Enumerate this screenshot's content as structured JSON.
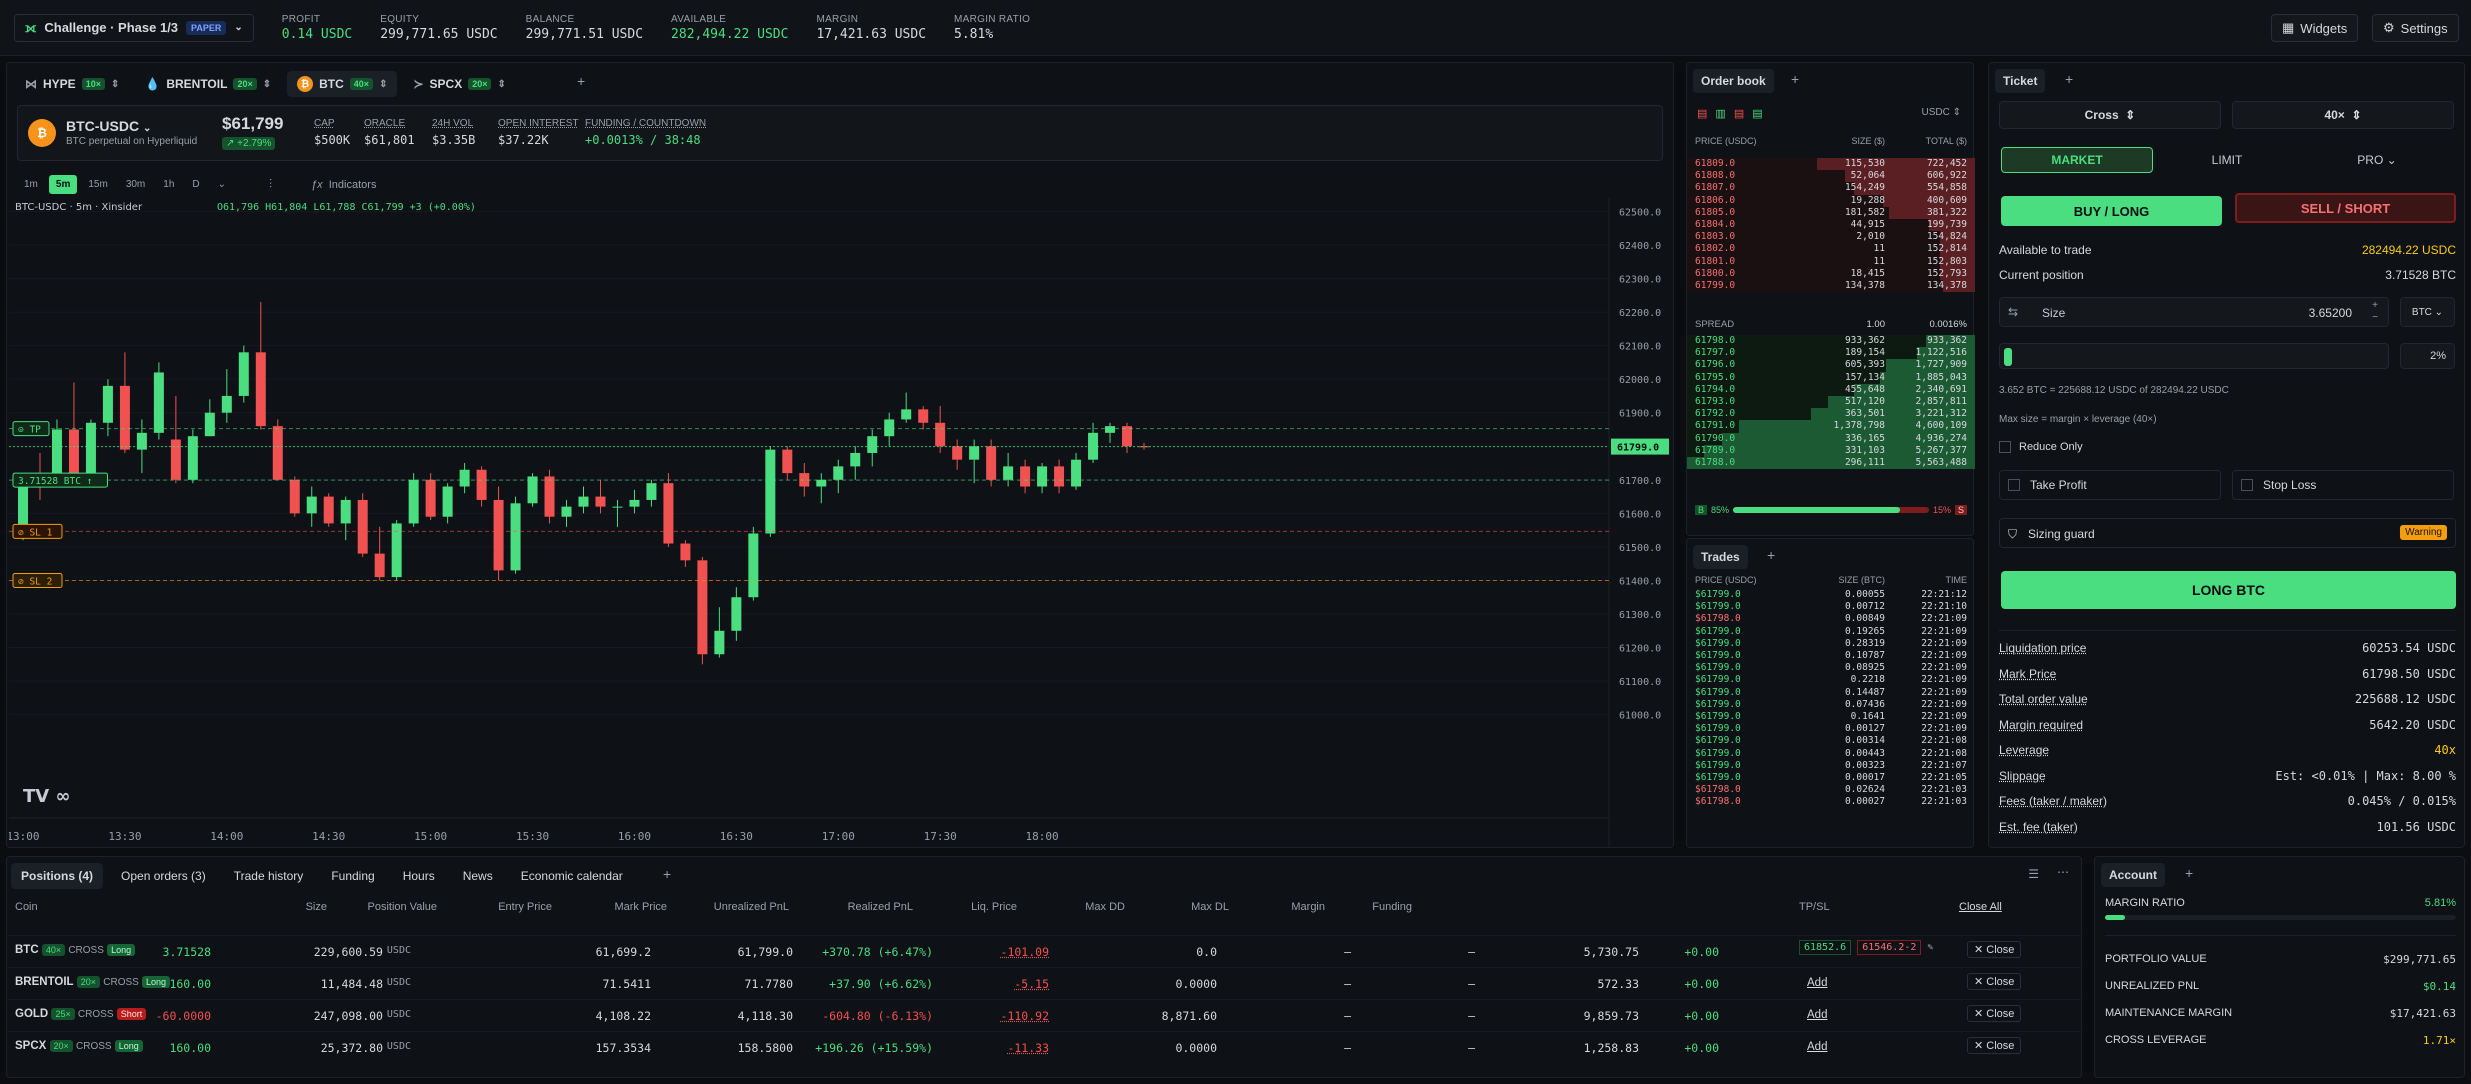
{
  "topbar": {
    "challenge": "Challenge · Phase 1/3",
    "mode": "PAPER",
    "stats": [
      {
        "label": "PROFIT",
        "value": "0.14 USDC",
        "color": "#4ade80"
      },
      {
        "label": "EQUITY",
        "value": "299,771.65 USDC",
        "color": "#d6d9de"
      },
      {
        "label": "BALANCE",
        "value": "299,771.51 USDC",
        "color": "#d6d9de"
      },
      {
        "label": "AVAILABLE",
        "value": "282,494.22 USDC",
        "color": "#4ade80"
      },
      {
        "label": "MARGIN",
        "value": "17,421.63 USDC",
        "color": "#d6d9de"
      },
      {
        "label": "MARGIN RATIO",
        "value": "5.81%",
        "color": "#d6d9de"
      }
    ],
    "widgets": "Widgets",
    "settings": "Settings"
  },
  "chart_tabs": [
    {
      "name": "HYPE",
      "lev": "10×"
    },
    {
      "name": "BRENTOIL",
      "lev": "20×"
    },
    {
      "name": "BTC",
      "lev": "40×"
    },
    {
      "name": "SPCX",
      "lev": "20×"
    }
  ],
  "market": {
    "pair": "BTC-USDC",
    "sub": "BTC perpetual on Hyperliquid",
    "price": "$61,799",
    "change": "+2.79%",
    "items": [
      {
        "label": "CAP",
        "value": "$500K"
      },
      {
        "label": "ORACLE",
        "value": "$61,801"
      },
      {
        "label": "24H VOL",
        "value": "$3.35B"
      },
      {
        "label": "OPEN INTEREST",
        "value": "$37.22K"
      },
      {
        "label": "FUNDING / COUNTDOWN",
        "value": "+0.0013% / 38:48"
      }
    ]
  },
  "timeframes": [
    "1m",
    "5m",
    "15m",
    "30m",
    "1h",
    "D"
  ],
  "indicators": "Indicators",
  "chart_data": {
    "type": "candlestick",
    "title": "BTC-USDC · 5m · Xinsider",
    "ohlc_legend": "O61,796 H61,804 L61,788 C61,799 +3 (+0.00%)",
    "yticks": [
      62500,
      62400,
      62300,
      62200,
      62100,
      62000,
      61900,
      61800,
      61700,
      61600,
      61500,
      61400,
      61300,
      61200,
      61100,
      61000
    ],
    "ylim": [
      60990,
      62540
    ],
    "xticks": [
      "13:00",
      "13:30",
      "14:00",
      "14:30",
      "15:00",
      "15:30",
      "16:00",
      "16:30",
      "17:00",
      "17:30",
      "18:00"
    ],
    "candles": [
      [
        61550,
        61720,
        61520,
        61700
      ],
      [
        61700,
        61780,
        61640,
        61690
      ],
      [
        61690,
        61880,
        61680,
        61850
      ],
      [
        61850,
        61990,
        61700,
        61720
      ],
      [
        61720,
        61880,
        61720,
        61870
      ],
      [
        61870,
        62000,
        61830,
        61980
      ],
      [
        61980,
        62080,
        61780,
        61790
      ],
      [
        61790,
        61880,
        61720,
        61840
      ],
      [
        61840,
        62050,
        61820,
        62020
      ],
      [
        61820,
        61950,
        61690,
        61700
      ],
      [
        61700,
        61850,
        61690,
        61830
      ],
      [
        61830,
        61940,
        61830,
        61900
      ],
      [
        61900,
        62030,
        61870,
        61950
      ],
      [
        61950,
        62100,
        61930,
        62080
      ],
      [
        62080,
        62230,
        61850,
        61860
      ],
      [
        61860,
        61880,
        61700,
        61700
      ],
      [
        61700,
        61710,
        61590,
        61600
      ],
      [
        61600,
        61680,
        61560,
        61650
      ],
      [
        61650,
        61660,
        61560,
        61570
      ],
      [
        61570,
        61650,
        61520,
        61640
      ],
      [
        61640,
        61660,
        61470,
        61480
      ],
      [
        61480,
        61560,
        61400,
        61410
      ],
      [
        61410,
        61580,
        61400,
        61570
      ],
      [
        61570,
        61720,
        61560,
        61700
      ],
      [
        61700,
        61720,
        61580,
        61590
      ],
      [
        61590,
        61690,
        61570,
        61680
      ],
      [
        61680,
        61750,
        61660,
        61730
      ],
      [
        61730,
        61740,
        61620,
        61640
      ],
      [
        61640,
        61680,
        61400,
        61430
      ],
      [
        61430,
        61650,
        61420,
        61630
      ],
      [
        61630,
        61720,
        61620,
        61710
      ],
      [
        61710,
        61730,
        61570,
        61590
      ],
      [
        61590,
        61640,
        61560,
        61620
      ],
      [
        61620,
        61680,
        61600,
        61650
      ],
      [
        61650,
        61700,
        61600,
        61620
      ],
      [
        61620,
        61640,
        61560,
        61620
      ],
      [
        61620,
        61670,
        61600,
        61640
      ],
      [
        61640,
        61700,
        61620,
        61690
      ],
      [
        61690,
        61720,
        61500,
        61510
      ],
      [
        61510,
        61520,
        61440,
        61460
      ],
      [
        61460,
        61470,
        61150,
        61180
      ],
      [
        61180,
        61320,
        61170,
        61250
      ],
      [
        61250,
        61380,
        61220,
        61350
      ],
      [
        61350,
        61560,
        61340,
        61540
      ],
      [
        61540,
        61800,
        61530,
        61790
      ],
      [
        61790,
        61800,
        61700,
        61720
      ],
      [
        61720,
        61750,
        61650,
        61680
      ],
      [
        61680,
        61720,
        61630,
        61700
      ],
      [
        61700,
        61760,
        61660,
        61740
      ],
      [
        61740,
        61800,
        61700,
        61780
      ],
      [
        61780,
        61850,
        61740,
        61830
      ],
      [
        61830,
        61900,
        61800,
        61880
      ],
      [
        61880,
        61960,
        61870,
        61910
      ],
      [
        61910,
        61920,
        61850,
        61870
      ],
      [
        61870,
        61920,
        61780,
        61800
      ],
      [
        61800,
        61820,
        61730,
        61760
      ],
      [
        61760,
        61820,
        61690,
        61800
      ],
      [
        61800,
        61820,
        61680,
        61700
      ],
      [
        61700,
        61780,
        61680,
        61740
      ],
      [
        61740,
        61760,
        61660,
        61680
      ],
      [
        61680,
        61750,
        61660,
        61740
      ],
      [
        61740,
        61760,
        61660,
        61680
      ],
      [
        61680,
        61780,
        61670,
        61760
      ],
      [
        61760,
        61870,
        61750,
        61840
      ],
      [
        61840,
        61870,
        61810,
        61860
      ],
      [
        61860,
        61870,
        61780,
        61800
      ],
      [
        61800,
        61810,
        61790,
        61799
      ]
    ],
    "hlines": [
      {
        "label": "TP",
        "price": 61852.6,
        "color": "#4ade80"
      },
      {
        "label": "3.71528 BTC",
        "price": 61699.2,
        "color": "#4ade80"
      },
      {
        "label": "SL 1",
        "price": 61546.2,
        "color": "#f05252"
      },
      {
        "label": "SL 2",
        "price": 61400,
        "color": "#f59e0b"
      }
    ],
    "last_price": "61799.0"
  },
  "orderbook": {
    "title": "Order book",
    "quote": "USDC",
    "headers": [
      "PRICE (USDC)",
      "SIZE ($)",
      "TOTAL ($)"
    ],
    "asks": [
      [
        "61809.0",
        "115,530",
        "722,452",
        0.55
      ],
      [
        "61808.0",
        "52,064",
        "606,922",
        0.45
      ],
      [
        "61807.0",
        "154,249",
        "554,858",
        0.42
      ],
      [
        "61806.0",
        "19,288",
        "400,609",
        0.32
      ],
      [
        "61805.0",
        "181,582",
        "381,322",
        0.3
      ],
      [
        "61804.0",
        "44,915",
        "199,739",
        0.16
      ],
      [
        "61803.0",
        "2,010",
        "154,824",
        0.12
      ],
      [
        "61802.0",
        "11",
        "152,814",
        0.12
      ],
      [
        "61801.0",
        "11",
        "152,803",
        0.12
      ],
      [
        "61800.0",
        "18,415",
        "152,793",
        0.12
      ],
      [
        "61799.0",
        "134,378",
        "134,378",
        0.11
      ]
    ],
    "spread": {
      "label": "SPREAD",
      "value": "1.00",
      "pct": "0.0016%"
    },
    "bids": [
      [
        "61798.0",
        "933,362",
        "933,362",
        0.17
      ],
      [
        "61797.0",
        "189,154",
        "1,122,516",
        0.2
      ],
      [
        "61796.0",
        "605,393",
        "1,727,909",
        0.31
      ],
      [
        "61795.0",
        "157,134",
        "1,885,043",
        0.33
      ],
      [
        "61794.0",
        "455,648",
        "2,340,691",
        0.42
      ],
      [
        "61793.0",
        "517,120",
        "2,857,811",
        0.51
      ],
      [
        "61792.0",
        "363,501",
        "3,221,312",
        0.57
      ],
      [
        "61791.0",
        "1,378,798",
        "4,600,109",
        0.82
      ],
      [
        "61790.0",
        "336,165",
        "4,936,274",
        0.88
      ],
      [
        "61789.0",
        "331,103",
        "5,267,377",
        0.94
      ],
      [
        "61788.0",
        "296,111",
        "5,563,488",
        1.0
      ]
    ],
    "ratio": {
      "b": "85%",
      "s": "15%"
    }
  },
  "trades": {
    "title": "Trades",
    "headers": [
      "PRICE (USDC)",
      "SIZE (BTC)",
      "TIME"
    ],
    "rows": [
      [
        "$61799.0",
        "0.00055",
        "22:21:12",
        "b"
      ],
      [
        "$61799.0",
        "0.00712",
        "22:21:10",
        "b"
      ],
      [
        "$61798.0",
        "0.00849",
        "22:21:09",
        "s"
      ],
      [
        "$61799.0",
        "0.19265",
        "22:21:09",
        "b"
      ],
      [
        "$61799.0",
        "0.28319",
        "22:21:09",
        "b"
      ],
      [
        "$61799.0",
        "0.10787",
        "22:21:09",
        "b"
      ],
      [
        "$61799.0",
        "0.08925",
        "22:21:09",
        "b"
      ],
      [
        "$61799.0",
        "0.2218",
        "22:21:09",
        "b"
      ],
      [
        "$61799.0",
        "0.14487",
        "22:21:09",
        "b"
      ],
      [
        "$61799.0",
        "0.07436",
        "22:21:09",
        "b"
      ],
      [
        "$61799.0",
        "0.1641",
        "22:21:09",
        "b"
      ],
      [
        "$61799.0",
        "0.00127",
        "22:21:09",
        "b"
      ],
      [
        "$61799.0",
        "0.00314",
        "22:21:08",
        "b"
      ],
      [
        "$61799.0",
        "0.00443",
        "22:21:08",
        "b"
      ],
      [
        "$61799.0",
        "0.00323",
        "22:21:07",
        "b"
      ],
      [
        "$61799.0",
        "0.00017",
        "22:21:05",
        "b"
      ],
      [
        "$61798.0",
        "0.02624",
        "22:21:03",
        "s"
      ],
      [
        "$61798.0",
        "0.00027",
        "22:21:03",
        "s"
      ]
    ]
  },
  "ticket": {
    "title": "Ticket",
    "margin_mode": "Cross",
    "leverage": "40×",
    "order_types": [
      "MARKET",
      "LIMIT",
      "PRO"
    ],
    "buy": "BUY / LONG",
    "sell": "SELL / SHORT",
    "available_label": "Available to trade",
    "available": "282494.22 USDC",
    "position_label": "Current position",
    "position": "3.71528 BTC",
    "size_label": "Size",
    "size": "3.65200",
    "size_unit": "BTC",
    "pct": "2%",
    "calc": "3.652 BTC = 225688.12 USDC of 282494.22 USDC",
    "maxsize": "Max size = margin × leverage (40×)",
    "reduce_only": "Reduce Only",
    "take_profit": "Take Profit",
    "stop_loss": "Stop Loss",
    "sizing_guard": "Sizing guard",
    "warning": "Warning",
    "submit": "LONG BTC",
    "details": [
      {
        "k": "Liquidation price",
        "v": "60253.54 USDC"
      },
      {
        "k": "Mark Price",
        "v": "61798.50 USDC"
      },
      {
        "k": "Total order value",
        "v": "225688.12 USDC"
      },
      {
        "k": "Margin required",
        "v": "5642.20 USDC"
      },
      {
        "k": "Leverage",
        "v": "40x"
      },
      {
        "k": "Slippage",
        "v": "Est: <0.01% | Max: 8.00 %"
      },
      {
        "k": "Fees (taker / maker)",
        "v": "0.045% / 0.015%"
      },
      {
        "k": "Est. fee (taker)",
        "v": "101.56 USDC"
      }
    ]
  },
  "bottom": {
    "tabs": [
      "Positions (4)",
      "Open orders (3)",
      "Trade history",
      "Funding",
      "Hours",
      "News",
      "Economic calendar"
    ],
    "headers": [
      "Coin",
      "Size",
      "Position Value",
      "Entry Price",
      "Mark Price",
      "Unrealized PnL",
      "Realized PnL",
      "Liq. Price",
      "Max DD",
      "Max DL",
      "Margin",
      "Funding",
      "TP/SL",
      "Close All"
    ],
    "positions": [
      {
        "coin": "BTC",
        "lev": "40×",
        "mode": "CROSS",
        "side": "Long",
        "size": "3.71528",
        "value": "229,600.59",
        "unit": "USDC",
        "entry": "61,699.2",
        "mark": "61,799.0",
        "upnl": "+370.78 (+6.47%)",
        "rpnl": "-101.09",
        "liq": "0.0",
        "maxdd": "–",
        "maxdl": "–",
        "margin": "5,730.75",
        "funding": "+0.00",
        "tp": "61852.6",
        "sl": "61546.2-2",
        "close": "Close"
      },
      {
        "coin": "BRENTOIL",
        "lev": "20×",
        "mode": "CROSS",
        "side": "Long",
        "size": "160.00",
        "value": "11,484.48",
        "unit": "USDC",
        "entry": "71.5411",
        "mark": "71.7780",
        "upnl": "+37.90 (+6.62%)",
        "rpnl": "-5.15",
        "liq": "0.0000",
        "maxdd": "–",
        "maxdl": "–",
        "margin": "572.33",
        "funding": "+0.00",
        "add": "Add",
        "close": "Close"
      },
      {
        "coin": "GOLD",
        "lev": "25×",
        "mode": "CROSS",
        "side": "Short",
        "size": "-60.0000",
        "value": "247,098.00",
        "unit": "USDC",
        "entry": "4,108.22",
        "mark": "4,118.30",
        "upnl": "-604.80 (-6.13%)",
        "rpnl": "-110.92",
        "liq": "8,871.60",
        "maxdd": "–",
        "maxdl": "–",
        "margin": "9,859.73",
        "funding": "+0.00",
        "add": "Add",
        "close": "Close"
      },
      {
        "coin": "SPCX",
        "lev": "20×",
        "mode": "CROSS",
        "side": "Long",
        "size": "160.00",
        "value": "25,372.80",
        "unit": "USDC",
        "entry": "157.3534",
        "mark": "158.5800",
        "upnl": "+196.26 (+15.59%)",
        "rpnl": "-11.33",
        "liq": "0.0000",
        "maxdd": "–",
        "maxdl": "–",
        "margin": "1,258.83",
        "funding": "+0.00",
        "add": "Add",
        "close": "Close"
      }
    ]
  },
  "account": {
    "title": "Account",
    "margin_ratio_label": "MARGIN RATIO",
    "margin_ratio": "5.81%",
    "margin_ratio_fill": 0.0581,
    "rows": [
      {
        "k": "PORTFOLIO VALUE",
        "v": "$299,771.65",
        "c": "#d6d9de"
      },
      {
        "k": "UNREALIZED PNL",
        "v": "$0.14",
        "c": "#4ade80"
      },
      {
        "k": "MAINTENANCE MARGIN",
        "v": "$17,421.63",
        "c": "#d6d9de"
      },
      {
        "k": "CROSS LEVERAGE",
        "v": "1.71×",
        "c": "#facc15"
      }
    ]
  }
}
